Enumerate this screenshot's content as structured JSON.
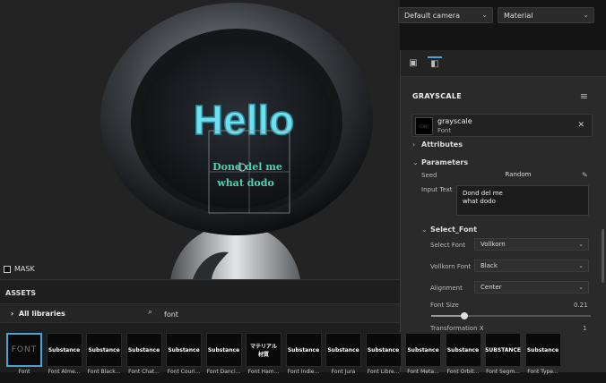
{
  "topbar": {
    "camera": "Default camera",
    "material": "Material"
  },
  "viewport": {
    "hello_text": "Hello",
    "font_preview_lines": [
      "Dond del me",
      "what dodo"
    ],
    "mask_label": "MASK"
  },
  "panel": {
    "section_title": "GRAYSCALE",
    "resource": {
      "name": "grayscale",
      "type": "Font"
    },
    "attributes_label": "Attributes",
    "parameters_label": "Parameters",
    "seed_label": "Seed",
    "seed_value": "Random",
    "input_text_label": "Input Text",
    "input_text_lines": [
      "Dond del me",
      "what dodo"
    ],
    "select_font_group": "Select_Font",
    "select_font_label": "Select Font",
    "select_font_value": "Vollkorn",
    "vollkorn_font_label": "Vollkorn Font",
    "vollkorn_font_value": "Black",
    "alignment_label": "Alignment",
    "alignment_value": "Center",
    "font_size_label": "Font Size",
    "font_size_value": "0.21",
    "transformation_label": "Transformation X",
    "transformation_value": "1"
  },
  "assets": {
    "title": "ASSETS",
    "libraries": "All libraries",
    "search_value": "font",
    "items": [
      {
        "thumb": "FONT",
        "caption": "Font"
      },
      {
        "thumb": "Substance",
        "caption": "Font Alme..."
      },
      {
        "thumb": "Substance",
        "caption": "Font Black..."
      },
      {
        "thumb": "Substance",
        "caption": "Font Chat..."
      },
      {
        "thumb": "Substance",
        "caption": "Font Couri..."
      },
      {
        "thumb": "Substance",
        "caption": "Font Danci..."
      },
      {
        "thumb": "マテリアル 材質",
        "caption": "Font Ham..."
      },
      {
        "thumb": "Substance",
        "caption": "Font Indie..."
      },
      {
        "thumb": "Substance",
        "caption": "Font Jura"
      },
      {
        "thumb": "Substance",
        "caption": "Font Libre..."
      },
      {
        "thumb": "Substance",
        "caption": "Font Meta..."
      },
      {
        "thumb": "Substance",
        "caption": "Font Orbit..."
      },
      {
        "thumb": "SUBSTANCE",
        "caption": "Font Segm..."
      },
      {
        "thumb": "Substance",
        "caption": "Font Type..."
      }
    ]
  },
  "colors": {
    "accent": "#4aa3d6",
    "hello_glow": "#6fe0f0",
    "background": "#232323"
  },
  "slider": {
    "font_size_fraction": 0.21
  }
}
